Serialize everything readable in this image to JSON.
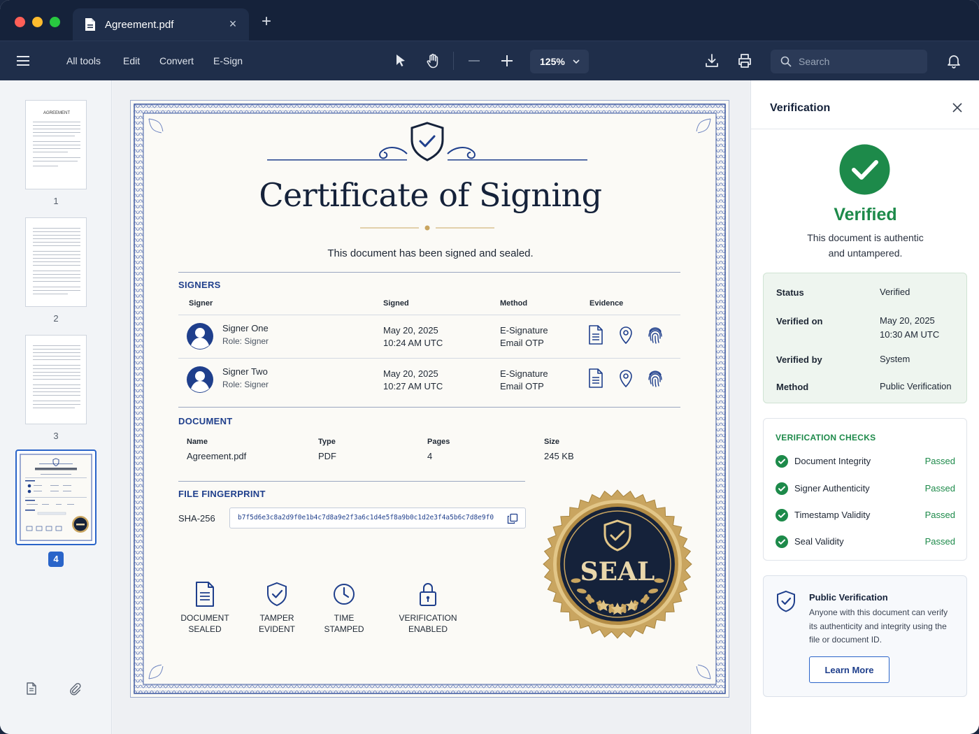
{
  "tab": {
    "title": "Agreement.pdf"
  },
  "toolbar": {
    "links": [
      "All tools",
      "Edit",
      "Convert",
      "E-Sign"
    ],
    "zoom": "125%",
    "search_placeholder": "Search"
  },
  "thumbnails": {
    "pages": [
      "1",
      "2",
      "3"
    ],
    "active_page": "4",
    "first_thumb_label": "AGREEMENT"
  },
  "certificate": {
    "title": "Certificate of Signing",
    "subtitle": "This document has been signed and sealed.",
    "signers_heading": "SIGNERS",
    "signer_columns": [
      "Signer",
      "Signed",
      "Method",
      "Evidence"
    ],
    "signers": [
      {
        "name": "Signer One",
        "role": "Role: Signer",
        "date": "May 20, 2025",
        "time": "10:24 AM UTC",
        "method": "E-Signature",
        "method_detail": "Email OTP"
      },
      {
        "name": "Signer Two",
        "role": "Role: Signer",
        "date": "May 20, 2025",
        "time": "10:27 AM UTC",
        "method": "E-Signature",
        "method_detail": "Email OTP"
      }
    ],
    "document_heading": "DOCUMENT",
    "document": {
      "name_label": "Name",
      "name": "Agreement.pdf",
      "type_label": "Type",
      "type": "PDF",
      "pages_label": "Pages",
      "pages": "4",
      "size_label": "Size",
      "size": "245 KB"
    },
    "fingerprint_heading": "FILE FINGERPRINT",
    "hash_label": "SHA-256",
    "hash": "b7f5d6e3c8a2d9f0e1b4c7d8a9e2f3a6c1d4e5f8a9b0c1d2e3f4a5b6c7d8e9f0",
    "features": [
      {
        "line1": "DOCUMENT",
        "line2": "SEALED"
      },
      {
        "line1": "TAMPER",
        "line2": "EVIDENT"
      },
      {
        "line1": "TIME",
        "line2": "STAMPED"
      },
      {
        "line1": "VERIFICATION",
        "line2": "ENABLED"
      }
    ],
    "seal_text": "SEAL"
  },
  "panel": {
    "title": "Verification",
    "status_title": "Verified",
    "status_desc_line1": "This document is authentic",
    "status_desc_line2": "and untampered.",
    "details": [
      {
        "key": "Status",
        "value": "Verified"
      },
      {
        "key": "Verified on",
        "value": "May 20, 2025",
        "value2": "10:30 AM UTC"
      },
      {
        "key": "Verified by",
        "value": "System"
      },
      {
        "key": "Method",
        "value": "Public Verification"
      }
    ],
    "checks_heading": "VERIFICATION CHECKS",
    "checks": [
      {
        "label": "Document Integrity",
        "status": "Passed"
      },
      {
        "label": "Signer Authenticity",
        "status": "Passed"
      },
      {
        "label": "Timestamp Validity",
        "status": "Passed"
      },
      {
        "label": "Seal Validity",
        "status": "Passed"
      }
    ],
    "public": {
      "title": "Public Verification",
      "desc": "Anyone with this document can verify its authenticity and integrity using the file or document ID.",
      "button": "Learn More"
    }
  },
  "colors": {
    "navy": "#15223a",
    "accent_blue": "#2a64c9",
    "success_green": "#1d8a4a",
    "gold": "#c9a560"
  }
}
